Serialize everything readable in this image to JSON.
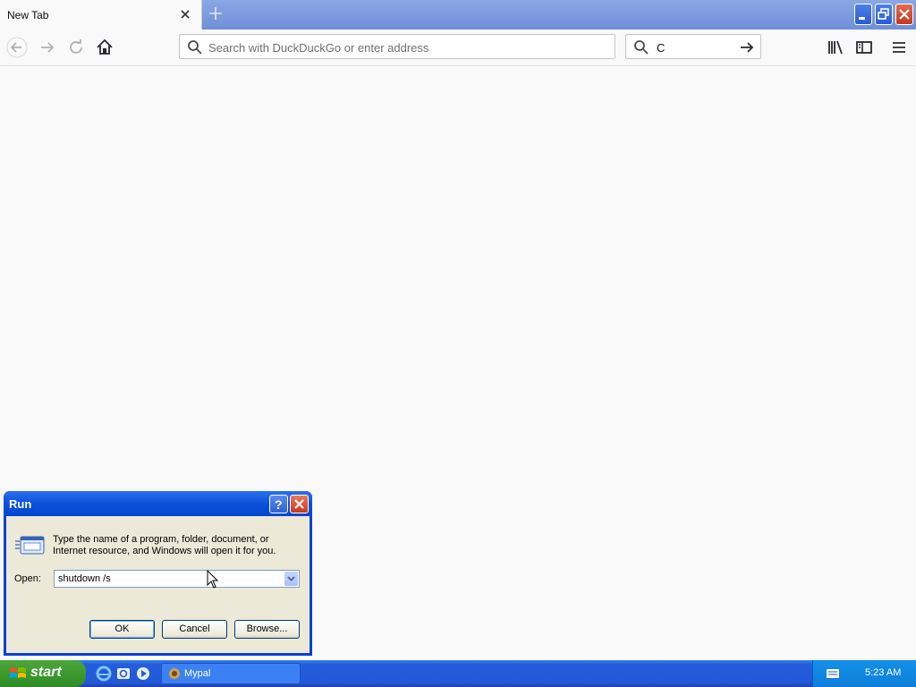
{
  "browser": {
    "tab_title": "New Tab",
    "url_placeholder": "Search with DuckDuckGo or enter address",
    "search_value": "C"
  },
  "run_dialog": {
    "title": "Run",
    "message": "Type the name of a program, folder, document, or Internet resource, and Windows will open it for you.",
    "open_label": "Open:",
    "open_value": "shutdown /s",
    "ok_label": "OK",
    "cancel_label": "Cancel",
    "browse_label": "Browse..."
  },
  "taskbar": {
    "start_label": "start",
    "task_label": "Mypal",
    "clock": "5:23 AM"
  },
  "colors": {
    "xp_blue": "#245edb",
    "start_green": "#3c9b2e",
    "close_red": "#c8391c"
  }
}
